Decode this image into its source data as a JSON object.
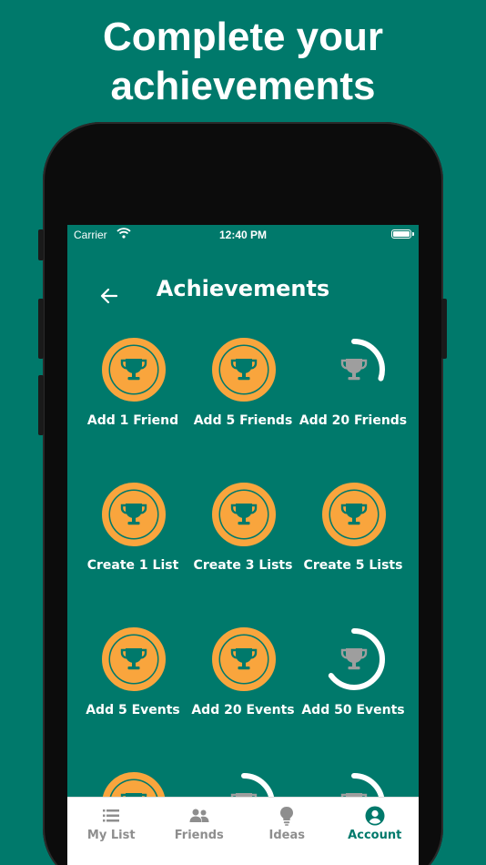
{
  "headline": {
    "line1": "Complete your",
    "line2": "achievements"
  },
  "status": {
    "carrier": "Carrier",
    "time": "12:40 PM"
  },
  "header": {
    "title": "Achievements"
  },
  "colors": {
    "background": "#00796b",
    "complete": "#f9a53d",
    "progress_track": "#ffffff",
    "locked_trophy": "#9e9e9e",
    "tab_active": "#00796b",
    "tab_inactive": "#8e8e8e"
  },
  "achievements": [
    {
      "label": "Add 1 Friend",
      "state": "complete",
      "progress": 1.0
    },
    {
      "label": "Add 5 Friends",
      "state": "complete",
      "progress": 1.0
    },
    {
      "label": "Add 20 Friends",
      "state": "in-progress",
      "progress": 0.3
    },
    {
      "label": "Create 1 List",
      "state": "complete",
      "progress": 1.0
    },
    {
      "label": "Create 3 Lists",
      "state": "complete",
      "progress": 1.0
    },
    {
      "label": "Create 5 Lists",
      "state": "complete",
      "progress": 1.0
    },
    {
      "label": "Add 5 Events",
      "state": "complete",
      "progress": 1.0
    },
    {
      "label": "Add 20 Events",
      "state": "complete",
      "progress": 1.0
    },
    {
      "label": "Add 50 Events",
      "state": "in-progress",
      "progress": 0.65
    },
    {
      "label": "",
      "state": "complete",
      "progress": 1.0
    },
    {
      "label": "",
      "state": "in-progress",
      "progress": 0.3
    },
    {
      "label": "",
      "state": "in-progress",
      "progress": 0.3
    }
  ],
  "tabs": [
    {
      "label": "My List",
      "icon": "list-icon",
      "active": false
    },
    {
      "label": "Friends",
      "icon": "people-icon",
      "active": false
    },
    {
      "label": "Ideas",
      "icon": "lightbulb-icon",
      "active": false
    },
    {
      "label": "Account",
      "icon": "account-circle-icon",
      "active": true
    }
  ]
}
